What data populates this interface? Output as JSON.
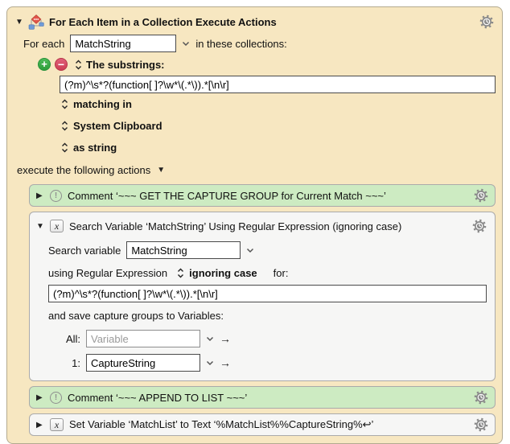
{
  "for_each": {
    "title": "For Each Item in a Collection Execute Actions",
    "for_each_label": "For each",
    "variable_value": "MatchString",
    "collections_label": "in these collections:",
    "substrings_label": "The substrings:",
    "regex_value": "(?m)^\\s*?(function[ ]?\\w*\\(.*\\)).*[\\n\\r]",
    "matching_in_label": "matching in",
    "collection_source": "System Clipboard",
    "as_type": "as string",
    "execute_label": "execute the following actions"
  },
  "actions": {
    "comment1": {
      "label": "Comment ‘~~~ GET THE CAPTURE GROUP for Current Match ~~~’"
    },
    "search": {
      "title": "Search Variable ‘MatchString’ Using Regular Expression (ignoring case)",
      "search_variable_label": "Search variable",
      "variable_value": "MatchString",
      "using_label": "using Regular Expression",
      "case_option": "ignoring case",
      "for_label": "for:",
      "regex_value": "(?m)^\\s*?(function[ ]?\\w*\\(.*\\)).*[\\n\\r]",
      "save_groups_label": "and save capture groups to Variables:",
      "all_label": "All:",
      "all_placeholder": "Variable",
      "group1_label": "1:",
      "group1_value": "CaptureString"
    },
    "comment2": {
      "label": "Comment ‘~~~ APPEND TO LIST ~~~’"
    },
    "set_variable": {
      "label": "Set Variable ‘MatchList’ to Text ‘%MatchList%%CaptureString%↩’"
    }
  },
  "colors": {
    "panel_bg": "#f7e7c1",
    "comment_bg": "#cdebc2",
    "action_bg": "#f6f6f5",
    "add_green": "#2d9e3a",
    "remove_red": "#ce3d53"
  }
}
